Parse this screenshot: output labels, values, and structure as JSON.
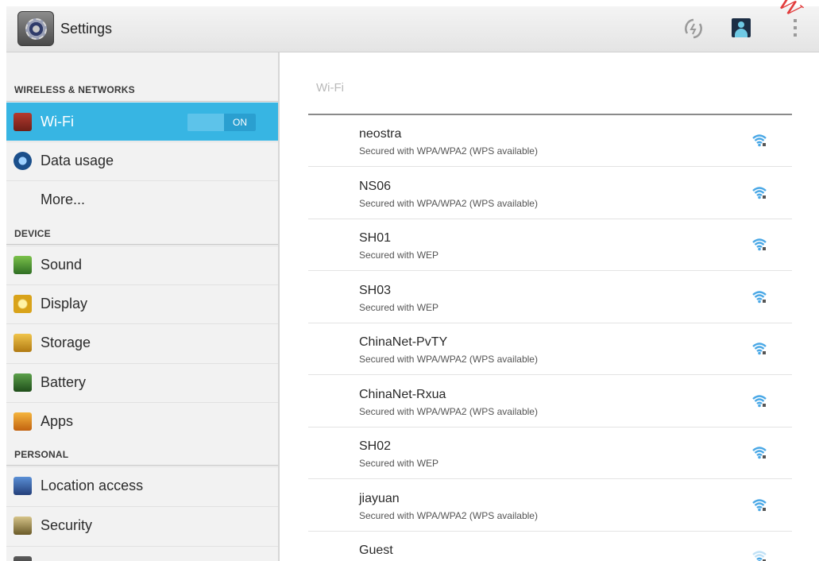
{
  "app": {
    "title": "Settings",
    "watermark": "W"
  },
  "colors": {
    "accent": "#37b5e3",
    "wifi_signal": "#4aa8e6"
  },
  "topbar": {
    "icons": [
      "settings-app-icon",
      "sync-icon",
      "account-icon",
      "overflow-menu-icon"
    ]
  },
  "sidebar": {
    "sections": {
      "wireless": "WIRELESS & NETWORKS",
      "device": "DEVICE",
      "personal": "PERSONAL"
    },
    "items": {
      "wifi": "Wi-Fi",
      "data_usage": "Data usage",
      "more": "More...",
      "sound": "Sound",
      "display": "Display",
      "storage": "Storage",
      "battery": "Battery",
      "apps": "Apps",
      "location": "Location access",
      "security": "Security"
    },
    "wifi_toggle": {
      "state": "ON"
    }
  },
  "main": {
    "title": "Wi-Fi",
    "networks": [
      {
        "ssid": "neostra",
        "security": "Secured with WPA/WPA2 (WPS available)",
        "signal": 4
      },
      {
        "ssid": "NS06",
        "security": "Secured with WPA/WPA2 (WPS available)",
        "signal": 4
      },
      {
        "ssid": "SH01",
        "security": "Secured with WEP",
        "signal": 3
      },
      {
        "ssid": "SH03",
        "security": "Secured with WEP",
        "signal": 3
      },
      {
        "ssid": "ChinaNet-PvTY",
        "security": "Secured with WPA/WPA2 (WPS available)",
        "signal": 3
      },
      {
        "ssid": "ChinaNet-Rxua",
        "security": "Secured with WPA/WPA2 (WPS available)",
        "signal": 3
      },
      {
        "ssid": "SH02",
        "security": "Secured with WEP",
        "signal": 3
      },
      {
        "ssid": "jiayuan",
        "security": "Secured with WPA/WPA2 (WPS available)",
        "signal": 3
      },
      {
        "ssid": "Guest",
        "security": "",
        "signal": 1
      }
    ]
  }
}
